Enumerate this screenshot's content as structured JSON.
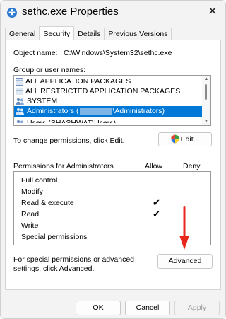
{
  "window": {
    "title": "sethc.exe Properties",
    "close_glyph": "✕"
  },
  "tabs": [
    {
      "label": "General",
      "active": false
    },
    {
      "label": "Security",
      "active": true
    },
    {
      "label": "Details",
      "active": false
    },
    {
      "label": "Previous Versions",
      "active": false
    }
  ],
  "object": {
    "label": "Object name:",
    "value": "C:\\Windows\\System32\\sethc.exe"
  },
  "groups": {
    "label": "Group or user names:",
    "items": [
      {
        "name": "ALL APPLICATION PACKAGES",
        "icon": "package-icon"
      },
      {
        "name": "ALL RESTRICTED APPLICATION PACKAGES",
        "icon": "package-icon"
      },
      {
        "name": "SYSTEM",
        "icon": "users-icon"
      },
      {
        "name_prefix": "Administrators (",
        "name_suffix": "\\Administrators)",
        "icon": "users-icon",
        "selected": true
      },
      {
        "name": "Users (SHASHWAT\\Users)",
        "icon": "users-icon"
      }
    ]
  },
  "change": {
    "label": "To change permissions, click Edit.",
    "edit_button": "Edit..."
  },
  "permissions": {
    "title": "Permissions for Administrators",
    "allow_header": "Allow",
    "deny_header": "Deny",
    "check_glyph": "✔",
    "rows": [
      {
        "name": "Full control",
        "allow": false,
        "deny": false
      },
      {
        "name": "Modify",
        "allow": false,
        "deny": false
      },
      {
        "name": "Read & execute",
        "allow": true,
        "deny": false
      },
      {
        "name": "Read",
        "allow": true,
        "deny": false
      },
      {
        "name": "Write",
        "allow": false,
        "deny": false
      },
      {
        "name": "Special permissions",
        "allow": false,
        "deny": false
      }
    ]
  },
  "advanced": {
    "text": "For special permissions or advanced settings, click Advanced.",
    "button": "Advanced"
  },
  "footer": {
    "ok": "OK",
    "cancel": "Cancel",
    "apply": "Apply"
  },
  "colors": {
    "selection": "#0078d7",
    "arrow": "#e8261b"
  }
}
